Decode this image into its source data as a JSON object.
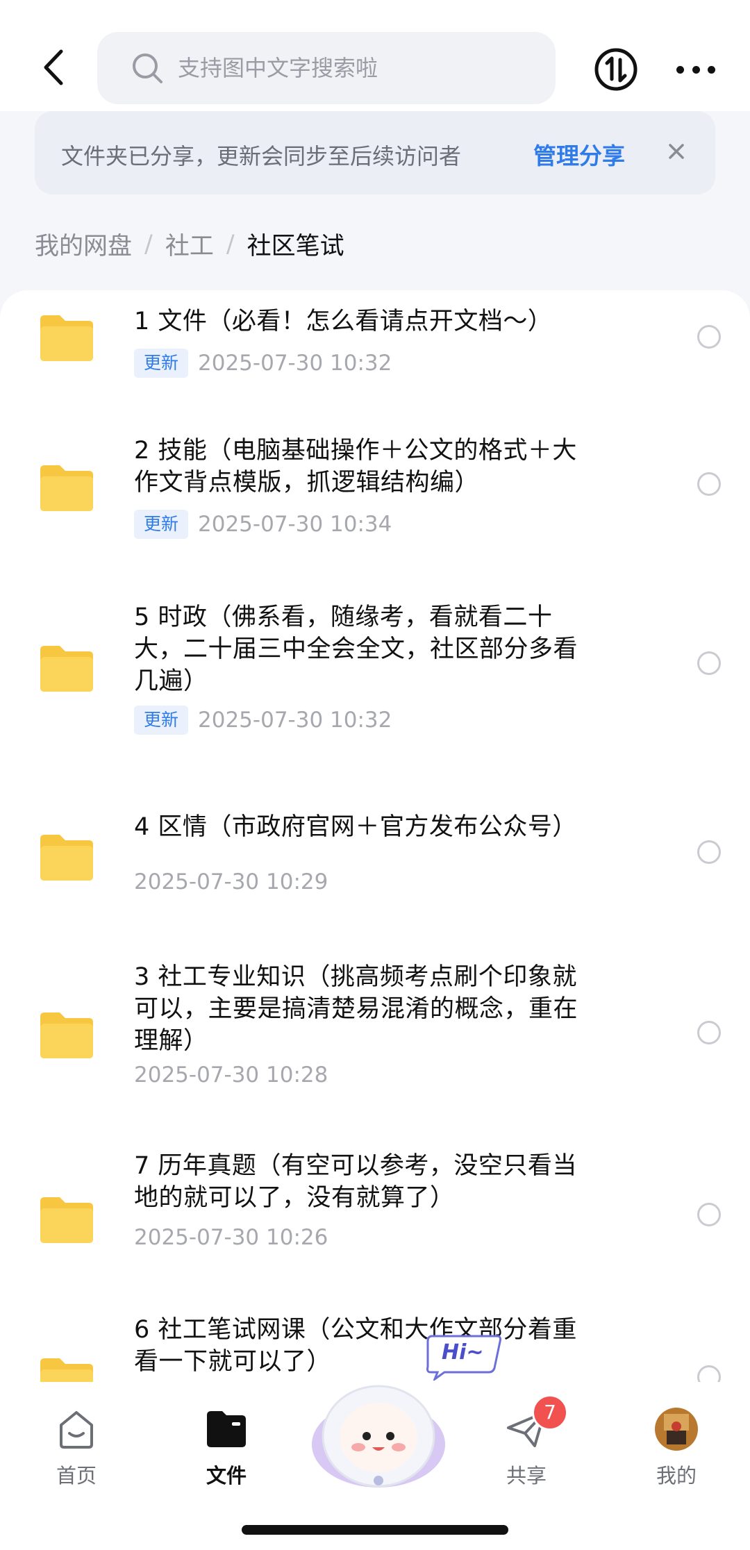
{
  "header": {
    "search_placeholder": "支持图中文字搜索啦"
  },
  "share_banner": {
    "text": "文件夹已分享，更新会同步至后续访问者",
    "link": "管理分享"
  },
  "breadcrumb": {
    "items": [
      "我的网盘",
      "社工",
      "社区笔试"
    ],
    "separator": "/"
  },
  "files": [
    {
      "title_lines": [
        "1 文件（必看！怎么看请点开文档～）"
      ],
      "badge": "更新",
      "date": "2025-07-30 10:32"
    },
    {
      "title_lines": [
        "2 技能（电脑基础操作＋公文的格式＋大",
        "作文背点模版，抓逻辑结构编）"
      ],
      "badge": "更新",
      "date": "2025-07-30 10:34"
    },
    {
      "title_lines": [
        "5 时政（佛系看，随缘考，看就看二十",
        "大，二十届三中全会全文，社区部分多看",
        "几遍）"
      ],
      "badge": "更新",
      "date": "2025-07-30 10:32"
    },
    {
      "title_lines": [
        "4 区情（市政府官网＋官方发布公众号）"
      ],
      "badge": "",
      "date": "2025-07-30 10:29"
    },
    {
      "title_lines": [
        "3 社工专业知识（挑高频考点刷个印象就",
        "可以，主要是搞清楚易混淆的概念，重在",
        "理解）"
      ],
      "badge": "",
      "date": "2025-07-30 10:28"
    },
    {
      "title_lines": [
        "7 历年真题（有空可以参考，没空只看当",
        "地的就可以了，没有就算了）"
      ],
      "badge": "",
      "date": "2025-07-30 10:26"
    },
    {
      "title_lines": [
        "6 社工笔试网课（公文和大作文部分着重",
        "看一下就可以了）"
      ],
      "badge": "",
      "date": ""
    }
  ],
  "bottom_nav": {
    "items": [
      {
        "label": "首页",
        "icon": "home-icon"
      },
      {
        "label": "文件",
        "icon": "folder-icon"
      },
      {
        "label": "共享",
        "icon": "paper-plane-icon",
        "badge": "7"
      },
      {
        "label": "我的",
        "icon": "avatar"
      }
    ],
    "mascot_bubble": "Hi~"
  },
  "colors": {
    "accent": "#2f7ce8",
    "folder": "#f8c742",
    "badge": "#f1524f"
  }
}
